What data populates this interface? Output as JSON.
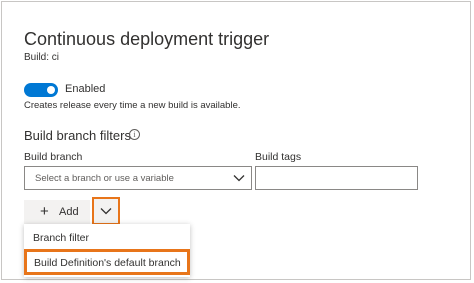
{
  "panel": {
    "title": "Continuous deployment trigger",
    "subtitle": "Build: ci",
    "toggle": {
      "label": "Enabled",
      "on": true
    },
    "help_text": "Creates release every time a new build is available.",
    "section_title": "Build branch filters",
    "info_glyph": "i"
  },
  "form": {
    "branch_label": "Build branch",
    "branch_placeholder": "Select a branch or use a variable",
    "tags_label": "Build tags"
  },
  "add_button": {
    "label": "Add",
    "icon": "plus-icon",
    "glyph": "+"
  },
  "dropdown_button": {
    "icon": "chevron-down-icon"
  },
  "menu": {
    "items": [
      {
        "label": "Branch filter"
      },
      {
        "label": "Build Definition's default branch"
      }
    ]
  },
  "colors": {
    "accent": "#0078d4",
    "highlight": "#e8751a"
  }
}
